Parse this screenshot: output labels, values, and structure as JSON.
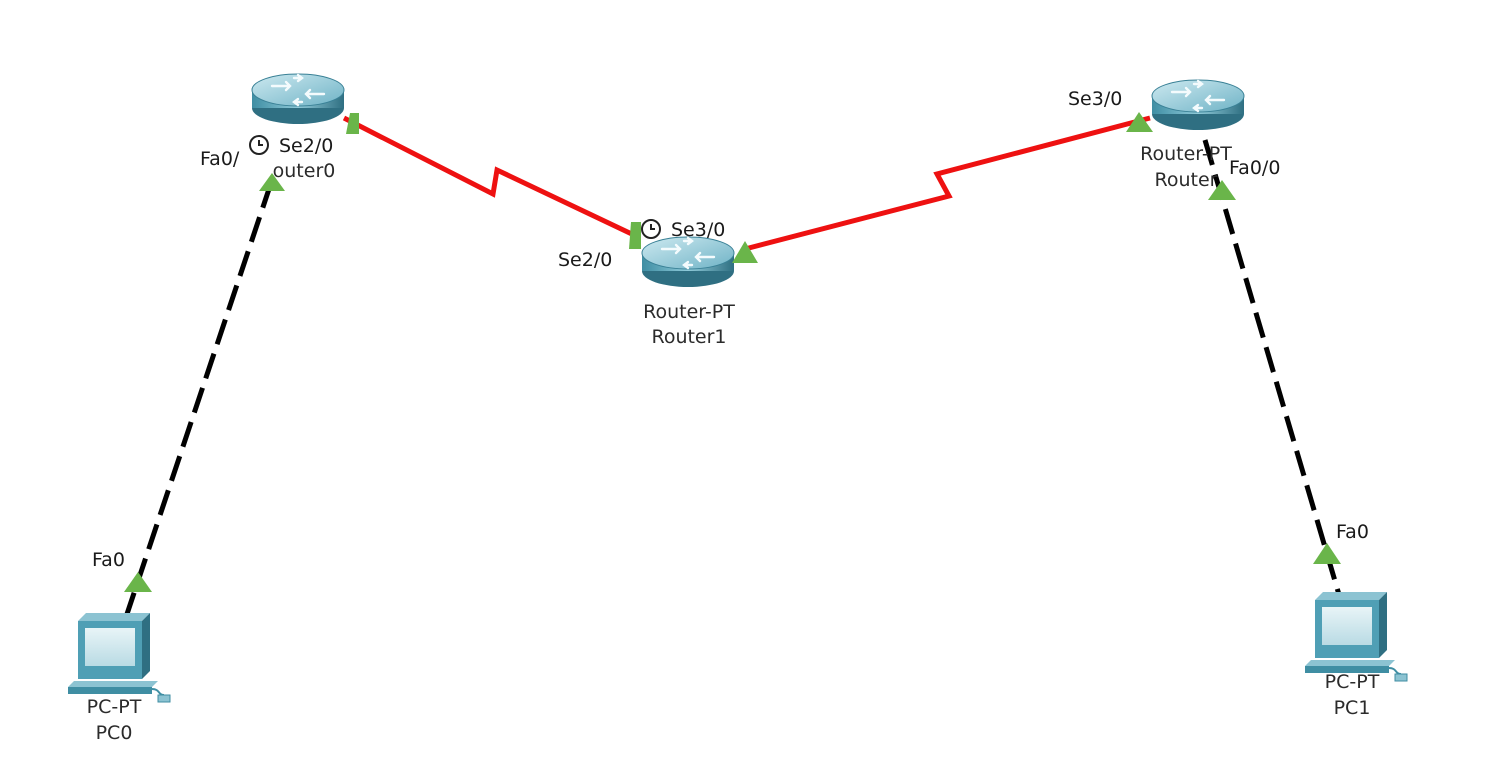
{
  "colors": {
    "serial_link": "#ee1111",
    "ethernet_link": "#000000",
    "port_up": "#6ab54a",
    "device_body": "#4f9fb5",
    "device_dark": "#2f6f82"
  },
  "devices": {
    "router0": {
      "model": "",
      "name": "outer0",
      "icon": "router-icon"
    },
    "router1": {
      "model": "Router-PT",
      "name": "Router1",
      "icon": "router-icon"
    },
    "router2": {
      "model": "Router-PT",
      "name": "Router",
      "icon": "router-icon"
    },
    "pc0": {
      "model": "PC-PT",
      "name": "PC0",
      "icon": "pc-icon"
    },
    "pc1": {
      "model": "PC-PT",
      "name": "PC1",
      "icon": "pc-icon"
    }
  },
  "links": [
    {
      "id": "r0-r1",
      "type": "serial",
      "a_port": "Se2/0",
      "b_port": "Se2/0",
      "clock_icon": "clock-icon"
    },
    {
      "id": "r1-r2",
      "type": "serial",
      "a_port": "Se3/0",
      "b_port": "Se3/0",
      "clock_icon": "clock-icon"
    },
    {
      "id": "r0-pc0",
      "type": "ethernet",
      "a_port": "Fa0/",
      "b_port": "Fa0"
    },
    {
      "id": "r2-pc1",
      "type": "ethernet",
      "a_port": "Fa0/0",
      "b_port": "Fa0"
    }
  ]
}
